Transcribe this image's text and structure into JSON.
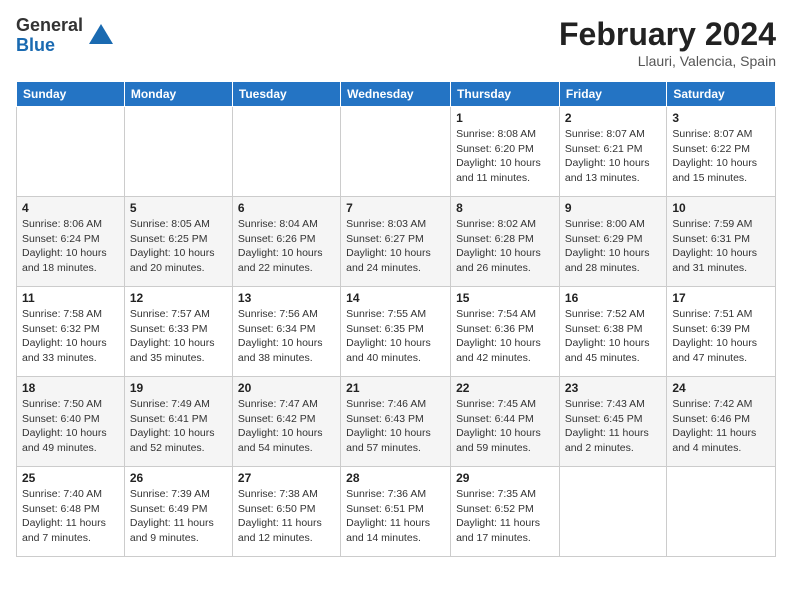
{
  "header": {
    "logo_general": "General",
    "logo_blue": "Blue",
    "month_year": "February 2024",
    "location": "Llauri, Valencia, Spain"
  },
  "weekdays": [
    "Sunday",
    "Monday",
    "Tuesday",
    "Wednesday",
    "Thursday",
    "Friday",
    "Saturday"
  ],
  "weeks": [
    [
      {
        "day": "",
        "info": ""
      },
      {
        "day": "",
        "info": ""
      },
      {
        "day": "",
        "info": ""
      },
      {
        "day": "",
        "info": ""
      },
      {
        "day": "1",
        "info": "Sunrise: 8:08 AM\nSunset: 6:20 PM\nDaylight: 10 hours\nand 11 minutes."
      },
      {
        "day": "2",
        "info": "Sunrise: 8:07 AM\nSunset: 6:21 PM\nDaylight: 10 hours\nand 13 minutes."
      },
      {
        "day": "3",
        "info": "Sunrise: 8:07 AM\nSunset: 6:22 PM\nDaylight: 10 hours\nand 15 minutes."
      }
    ],
    [
      {
        "day": "4",
        "info": "Sunrise: 8:06 AM\nSunset: 6:24 PM\nDaylight: 10 hours\nand 18 minutes."
      },
      {
        "day": "5",
        "info": "Sunrise: 8:05 AM\nSunset: 6:25 PM\nDaylight: 10 hours\nand 20 minutes."
      },
      {
        "day": "6",
        "info": "Sunrise: 8:04 AM\nSunset: 6:26 PM\nDaylight: 10 hours\nand 22 minutes."
      },
      {
        "day": "7",
        "info": "Sunrise: 8:03 AM\nSunset: 6:27 PM\nDaylight: 10 hours\nand 24 minutes."
      },
      {
        "day": "8",
        "info": "Sunrise: 8:02 AM\nSunset: 6:28 PM\nDaylight: 10 hours\nand 26 minutes."
      },
      {
        "day": "9",
        "info": "Sunrise: 8:00 AM\nSunset: 6:29 PM\nDaylight: 10 hours\nand 28 minutes."
      },
      {
        "day": "10",
        "info": "Sunrise: 7:59 AM\nSunset: 6:31 PM\nDaylight: 10 hours\nand 31 minutes."
      }
    ],
    [
      {
        "day": "11",
        "info": "Sunrise: 7:58 AM\nSunset: 6:32 PM\nDaylight: 10 hours\nand 33 minutes."
      },
      {
        "day": "12",
        "info": "Sunrise: 7:57 AM\nSunset: 6:33 PM\nDaylight: 10 hours\nand 35 minutes."
      },
      {
        "day": "13",
        "info": "Sunrise: 7:56 AM\nSunset: 6:34 PM\nDaylight: 10 hours\nand 38 minutes."
      },
      {
        "day": "14",
        "info": "Sunrise: 7:55 AM\nSunset: 6:35 PM\nDaylight: 10 hours\nand 40 minutes."
      },
      {
        "day": "15",
        "info": "Sunrise: 7:54 AM\nSunset: 6:36 PM\nDaylight: 10 hours\nand 42 minutes."
      },
      {
        "day": "16",
        "info": "Sunrise: 7:52 AM\nSunset: 6:38 PM\nDaylight: 10 hours\nand 45 minutes."
      },
      {
        "day": "17",
        "info": "Sunrise: 7:51 AM\nSunset: 6:39 PM\nDaylight: 10 hours\nand 47 minutes."
      }
    ],
    [
      {
        "day": "18",
        "info": "Sunrise: 7:50 AM\nSunset: 6:40 PM\nDaylight: 10 hours\nand 49 minutes."
      },
      {
        "day": "19",
        "info": "Sunrise: 7:49 AM\nSunset: 6:41 PM\nDaylight: 10 hours\nand 52 minutes."
      },
      {
        "day": "20",
        "info": "Sunrise: 7:47 AM\nSunset: 6:42 PM\nDaylight: 10 hours\nand 54 minutes."
      },
      {
        "day": "21",
        "info": "Sunrise: 7:46 AM\nSunset: 6:43 PM\nDaylight: 10 hours\nand 57 minutes."
      },
      {
        "day": "22",
        "info": "Sunrise: 7:45 AM\nSunset: 6:44 PM\nDaylight: 10 hours\nand 59 minutes."
      },
      {
        "day": "23",
        "info": "Sunrise: 7:43 AM\nSunset: 6:45 PM\nDaylight: 11 hours\nand 2 minutes."
      },
      {
        "day": "24",
        "info": "Sunrise: 7:42 AM\nSunset: 6:46 PM\nDaylight: 11 hours\nand 4 minutes."
      }
    ],
    [
      {
        "day": "25",
        "info": "Sunrise: 7:40 AM\nSunset: 6:48 PM\nDaylight: 11 hours\nand 7 minutes."
      },
      {
        "day": "26",
        "info": "Sunrise: 7:39 AM\nSunset: 6:49 PM\nDaylight: 11 hours\nand 9 minutes."
      },
      {
        "day": "27",
        "info": "Sunrise: 7:38 AM\nSunset: 6:50 PM\nDaylight: 11 hours\nand 12 minutes."
      },
      {
        "day": "28",
        "info": "Sunrise: 7:36 AM\nSunset: 6:51 PM\nDaylight: 11 hours\nand 14 minutes."
      },
      {
        "day": "29",
        "info": "Sunrise: 7:35 AM\nSunset: 6:52 PM\nDaylight: 11 hours\nand 17 minutes."
      },
      {
        "day": "",
        "info": ""
      },
      {
        "day": "",
        "info": ""
      }
    ]
  ]
}
